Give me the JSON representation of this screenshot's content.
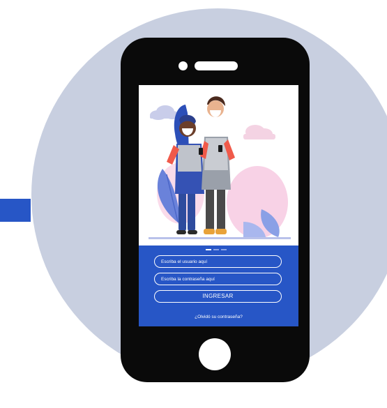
{
  "colors": {
    "accent": "#2756c6",
    "background_circle": "#c8cfe0",
    "phone_body": "#0a0a0a"
  },
  "login": {
    "username_placeholder": "Escriba el usuario aquí",
    "password_placeholder": "Escriba la contraseña aquí",
    "submit_label": "INGRESAR",
    "forgot_link": "¿Olvidó su contraseña?"
  },
  "carousel": {
    "page_count": 3,
    "active_index": 0
  },
  "illustration": {
    "subject": "two-people-with-masks-using-phones"
  }
}
